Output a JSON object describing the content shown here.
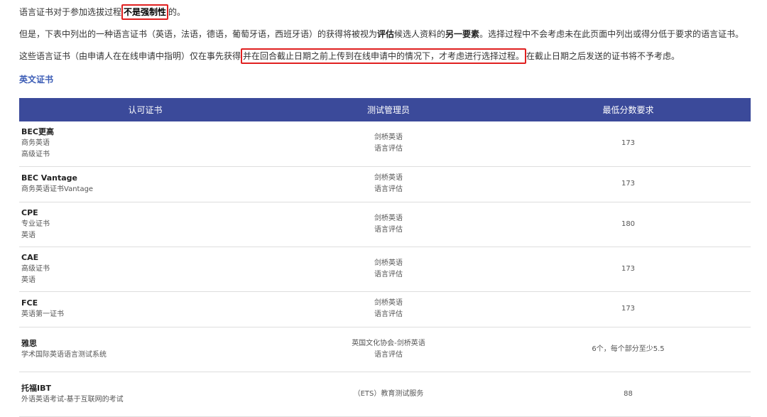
{
  "intro": {
    "p1": {
      "before": "语言证书对于参加选拔过程",
      "highlight": "不是强制性",
      "after": "的。"
    },
    "p2": {
      "part1": "但是，下表中列出的一种语言证书（英语，法语，德语，葡萄牙语，西班牙语）的获得将被视为",
      "bold1": "评估",
      "part2": "候选人资料的",
      "bold2": "另一要素",
      "part3": "。选择过程中不会考虑未在此页面中列出或得分低于要求的语言证书。"
    },
    "p3": {
      "before": "这些语言证书（由申请人在在线申请中指明）仅在事先获得",
      "highlight": "并在回合截止日期之前上传到在线申请中的情况下，才考虑进行选择过程。",
      "after": "在截止日期之后发送的证书将不予考虑。"
    }
  },
  "section_title": "英文证书",
  "table": {
    "headers": [
      "认可证书",
      "测试管理员",
      "最低分数要求"
    ],
    "rows": [
      {
        "name": "BEC更高",
        "desc": [
          "商务英语",
          "高级证书"
        ],
        "admin": [
          "剑桥英语",
          "语言评估"
        ],
        "score": "173"
      },
      {
        "name": "BEC Vantage",
        "desc": [
          "商务英语证书Vantage"
        ],
        "admin": [
          "剑桥英语",
          "语言评估"
        ],
        "score": "173"
      },
      {
        "name": "CPE",
        "desc": [
          "专业证书",
          "英语"
        ],
        "admin": [
          "剑桥英语",
          "语言评估"
        ],
        "score": "180"
      },
      {
        "name": "CAE",
        "desc": [
          "高级证书",
          "英语"
        ],
        "admin": [
          "剑桥英语",
          "语言评估"
        ],
        "score": "173"
      },
      {
        "name": "FCE",
        "desc": [
          "英语第一证书"
        ],
        "admin": [
          "剑桥英语",
          "语言评估"
        ],
        "score": "173"
      },
      {
        "name": "雅思",
        "desc": [
          "学术国际英语语言测试系统"
        ],
        "admin": [
          "英国文化协会-剑桥英语",
          "语言评估"
        ],
        "score": "6个，每个部分至少5.5"
      },
      {
        "name": "托福IBT",
        "desc": [
          "外语英语考试-基于互联网的考试"
        ],
        "admin": [
          "（ETS）教育测试服务"
        ],
        "score": "88"
      }
    ]
  }
}
